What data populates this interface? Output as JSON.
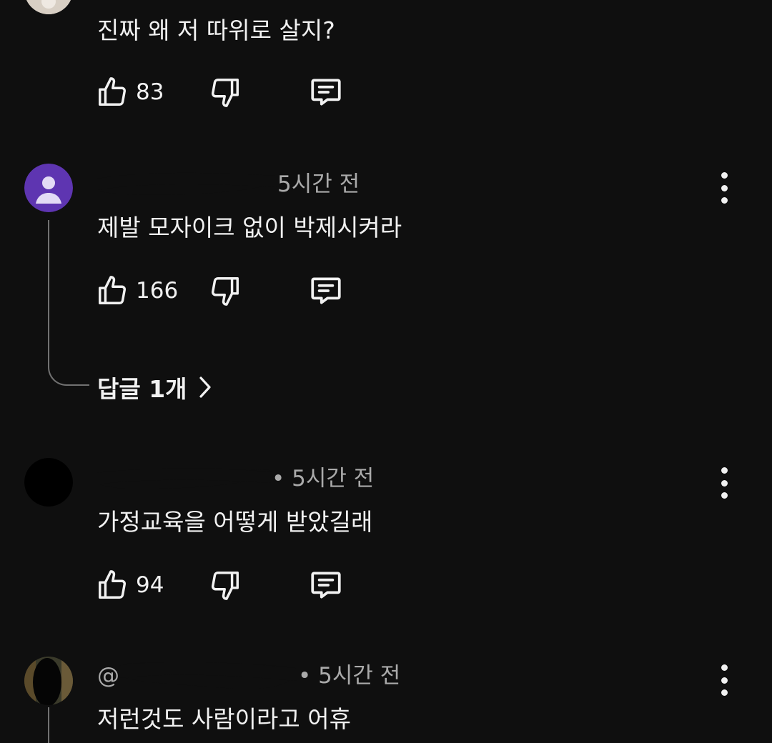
{
  "comments": [
    {
      "author_fragment": "",
      "time": "",
      "text": "진짜 왜 저 따위로 살지?",
      "likes": "83",
      "avatar_color": "#d8cfc4"
    },
    {
      "author_fragment": "",
      "time": "5시간 전",
      "text": "제발 모자이크 없이 박제시켜라",
      "likes": "166",
      "avatar_color": "#5e35b1",
      "replies_label": "답글 1개"
    },
    {
      "author_fragment": "",
      "time": "• 5시간 전",
      "text": "가정교육을 어떻게 받았길래",
      "likes": "94",
      "avatar_color": "#000000"
    },
    {
      "author_fragment": "@",
      "time": "• 5시간 전",
      "text": "저런것도 사람이라고 어휴",
      "likes": "",
      "avatar_color": "#3a3a2a"
    }
  ],
  "icons": {
    "like": "thumbs-up-icon",
    "dislike": "thumbs-down-icon",
    "reply": "comment-icon",
    "more": "more-vertical-icon",
    "chevron": "chevron-right-icon"
  },
  "colors": {
    "background": "#0f0f0f",
    "text": "#f1f1f1",
    "secondary_text": "#aaaaaa",
    "thread_line": "#717171"
  }
}
